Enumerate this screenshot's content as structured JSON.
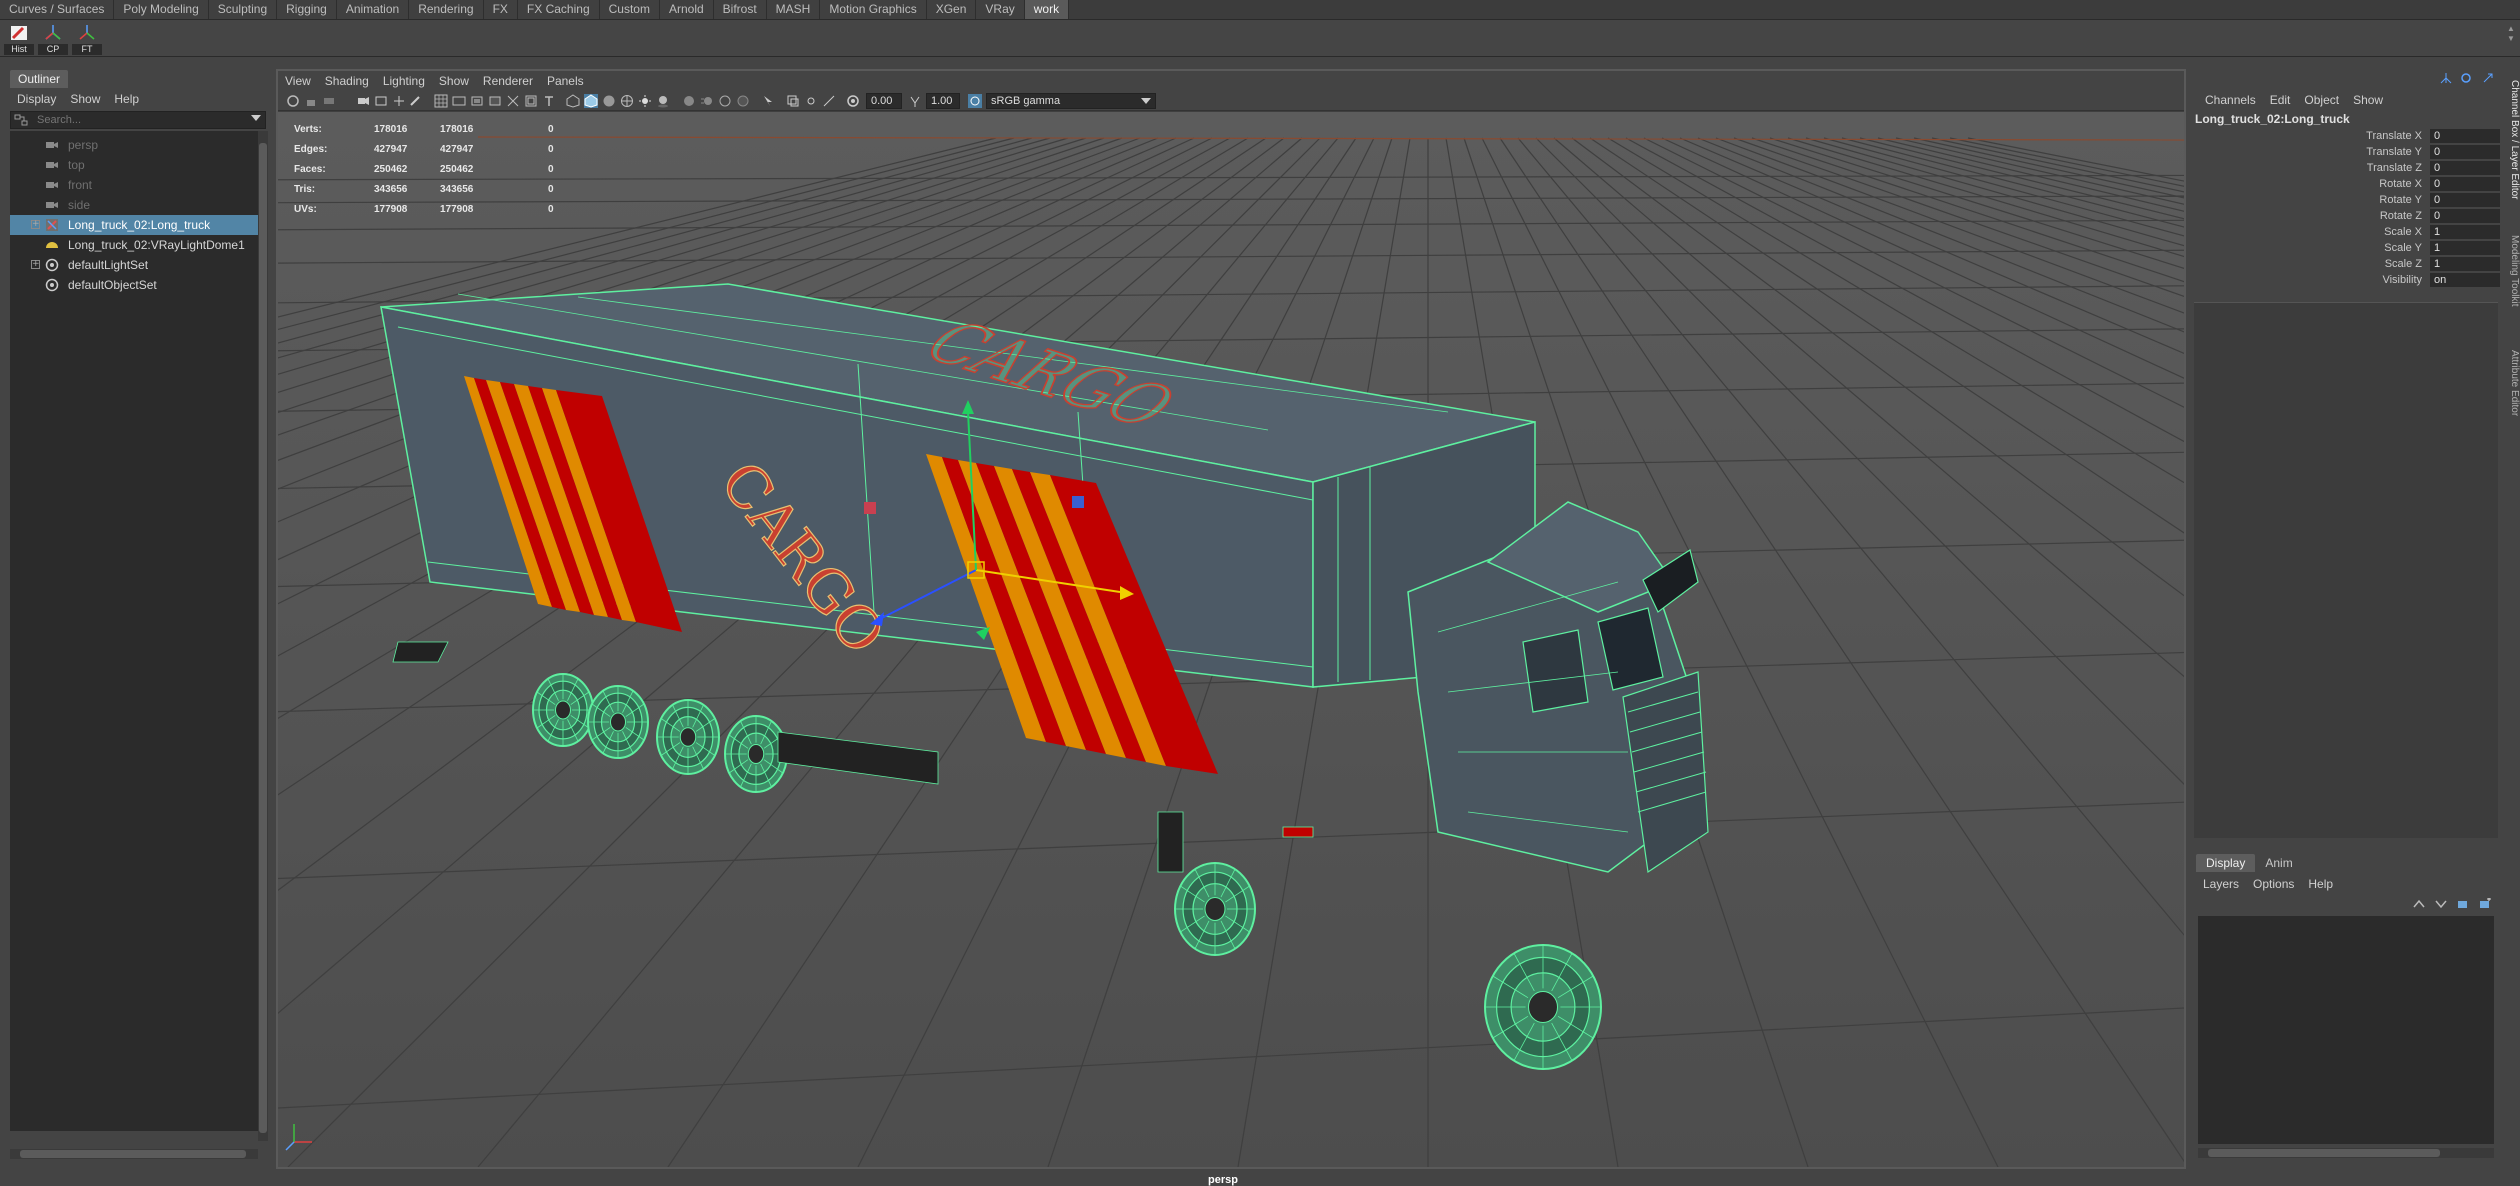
{
  "shelf_tabs": [
    "Curves / Surfaces",
    "Poly Modeling",
    "Sculpting",
    "Rigging",
    "Animation",
    "Rendering",
    "FX",
    "FX Caching",
    "Custom",
    "Arnold",
    "Bifrost",
    "MASH",
    "Motion Graphics",
    "XGen",
    "VRay",
    "work"
  ],
  "active_shelf_tab": "work",
  "shelf": {
    "buttons": [
      {
        "label": "Hist",
        "icon": "history-delete-icon"
      },
      {
        "label": "CP",
        "icon": "center-pivot-icon"
      },
      {
        "label": "FT",
        "icon": "freeze-transform-icon"
      }
    ]
  },
  "outliner": {
    "tab": "Outliner",
    "menu": [
      "Display",
      "Show",
      "Help"
    ],
    "search_placeholder": "Search...",
    "items": [
      {
        "label": "persp",
        "icon": "camera-icon",
        "dim": true,
        "selected": false,
        "expandable": false
      },
      {
        "label": "top",
        "icon": "camera-icon",
        "dim": true,
        "selected": false,
        "expandable": false
      },
      {
        "label": "front",
        "icon": "camera-icon",
        "dim": true,
        "selected": false,
        "expandable": false
      },
      {
        "label": "side",
        "icon": "camera-icon",
        "dim": true,
        "selected": false,
        "expandable": false
      },
      {
        "label": "Long_truck_02:Long_truck",
        "icon": "transform-icon",
        "dim": false,
        "selected": true,
        "expandable": true
      },
      {
        "label": "Long_truck_02:VRayLightDome1",
        "icon": "dome-light-icon",
        "dim": false,
        "selected": false,
        "expandable": false
      },
      {
        "label": "defaultLightSet",
        "icon": "set-icon",
        "dim": false,
        "selected": false,
        "expandable": true
      },
      {
        "label": "defaultObjectSet",
        "icon": "set-icon",
        "dim": false,
        "selected": false,
        "expandable": false
      }
    ]
  },
  "viewport": {
    "menu": [
      "View",
      "Shading",
      "Lighting",
      "Show",
      "Renderer",
      "Panels"
    ],
    "exposure": "0.00",
    "gamma": "1.00",
    "color_space": "sRGB gamma",
    "camera": "persp",
    "hud": [
      {
        "label": "Verts:",
        "a": "178016",
        "b": "178016",
        "c": "0"
      },
      {
        "label": "Edges:",
        "a": "427947",
        "b": "427947",
        "c": "0"
      },
      {
        "label": "Faces:",
        "a": "250462",
        "b": "250462",
        "c": "0"
      },
      {
        "label": "Tris:",
        "a": "343656",
        "b": "343656",
        "c": "0"
      },
      {
        "label": "UVs:",
        "a": "177908",
        "b": "177908",
        "c": "0"
      }
    ],
    "decal_text": "CARGO",
    "colors": {
      "wire": "#5ef0a0",
      "body": "#4d5a66",
      "stripe_red": "#c00000",
      "stripe_orange": "#e08a00",
      "grid": "#3a3a3a",
      "background": "#575757"
    }
  },
  "channel_box": {
    "menu": [
      "Channels",
      "Edit",
      "Object",
      "Show"
    ],
    "node": "Long_truck_02:Long_truck",
    "attributes": [
      {
        "name": "Translate X",
        "value": "0"
      },
      {
        "name": "Translate Y",
        "value": "0"
      },
      {
        "name": "Translate Z",
        "value": "0"
      },
      {
        "name": "Rotate X",
        "value": "0"
      },
      {
        "name": "Rotate Y",
        "value": "0"
      },
      {
        "name": "Rotate Z",
        "value": "0"
      },
      {
        "name": "Scale X",
        "value": "1"
      },
      {
        "name": "Scale Y",
        "value": "1"
      },
      {
        "name": "Scale Z",
        "value": "1"
      },
      {
        "name": "Visibility",
        "value": "on"
      }
    ]
  },
  "layer_editor": {
    "tabs": [
      "Display",
      "Anim"
    ],
    "active_tab": "Display",
    "menu": [
      "Layers",
      "Options",
      "Help"
    ]
  },
  "side_tabs": [
    "Channel Box / Layer Editor",
    "Modeling Toolkit",
    "Attribute Editor"
  ]
}
